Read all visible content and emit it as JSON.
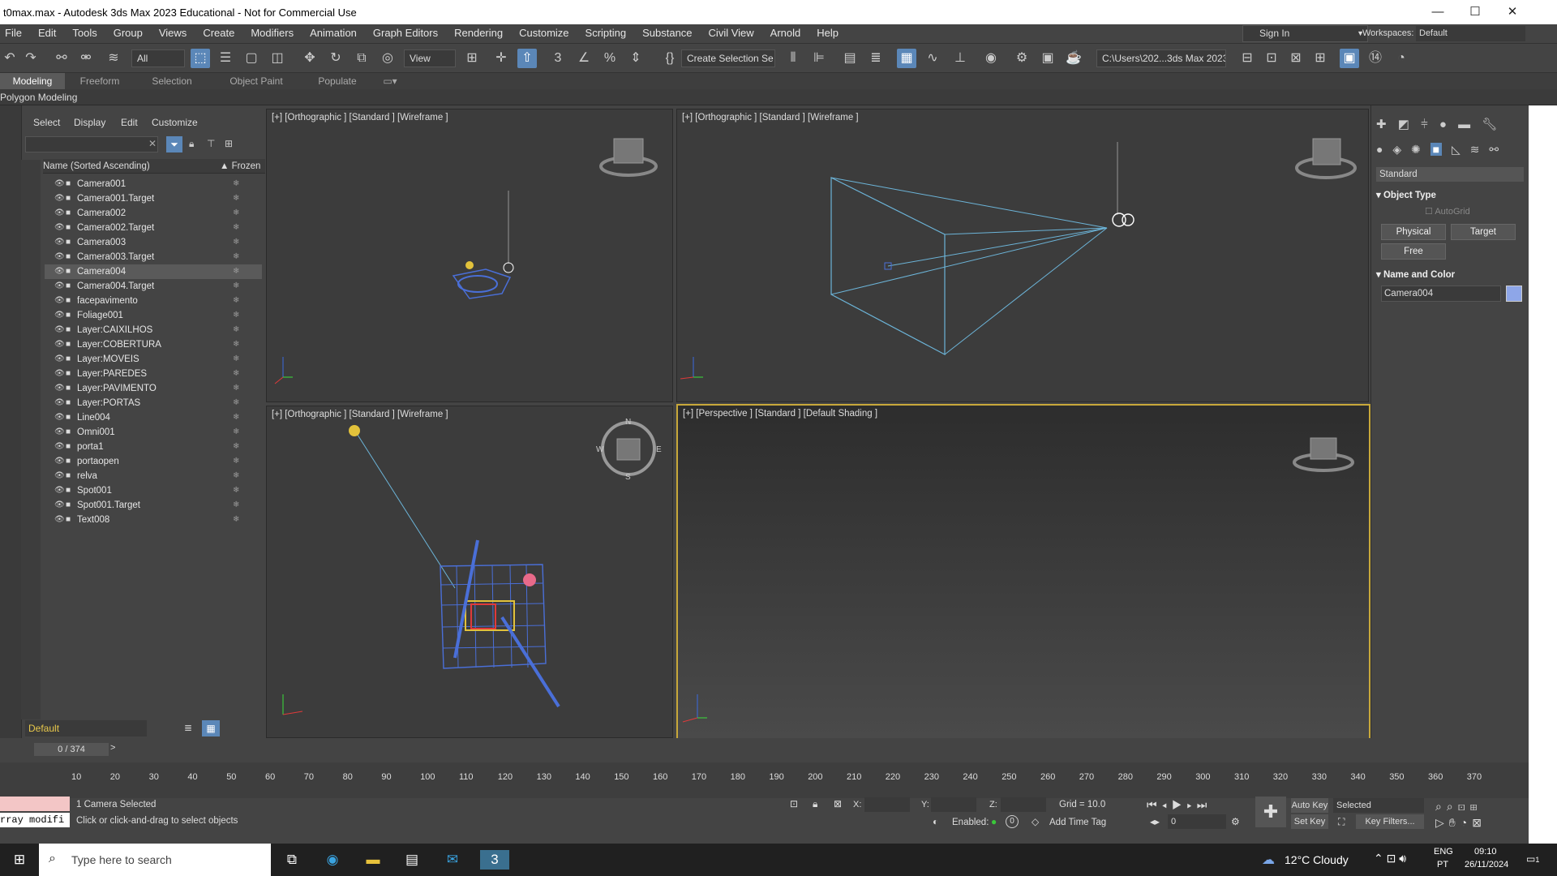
{
  "window": {
    "title": "t0max.max - Autodesk 3ds Max 2023 Educational - Not for Commercial Use",
    "minimize": "—",
    "maximize": "☐",
    "close": "✕"
  },
  "menu": [
    "File",
    "Edit",
    "Tools",
    "Group",
    "Views",
    "Create",
    "Modifiers",
    "Animation",
    "Graph Editors",
    "Rendering",
    "Customize",
    "Scripting",
    "Substance",
    "Civil View",
    "Arnold",
    "Help"
  ],
  "signin": "Sign In",
  "workspaces_label": "Workspaces:",
  "workspace": "Default",
  "toolbar": {
    "filter": "All",
    "refcoord": "View",
    "selset": "Create Selection Se",
    "path": "C:\\Users\\202...3ds Max 2023"
  },
  "ribbon_tabs": [
    "Modeling",
    "Freeform",
    "Selection",
    "Object Paint",
    "Populate"
  ],
  "sub_ribbon": "Polygon Modeling",
  "scene": {
    "tabs": [
      "Select",
      "Display",
      "Edit",
      "Customize"
    ],
    "col_name": "Name (Sorted Ascending)",
    "col_frozen": "▲ Frozen",
    "items": [
      "Camera001",
      "Camera001.Target",
      "Camera002",
      "Camera002.Target",
      "Camera003",
      "Camera003.Target",
      "Camera004",
      "Camera004.Target",
      "facepavimento",
      "Foliage001",
      "Layer:CAIXILHOS",
      "Layer:COBERTURA",
      "Layer:MOVEIS",
      "Layer:PAREDES",
      "Layer:PAVIMENTO",
      "Layer:PORTAS",
      "Line004",
      "Omni001",
      "porta1",
      "portaopen",
      "relva",
      "Spot001",
      "Spot001.Target",
      "Text008"
    ],
    "selected_index": 6,
    "layer": "Default"
  },
  "viewports": {
    "tl": "[+] [Orthographic ] [Standard ] [Wireframe ]",
    "tr": "[+] [Orthographic ] [Standard ] [Wireframe ]",
    "bl": "[+] [Orthographic ] [Standard ] [Wireframe ]",
    "br": "[+] [Perspective ] [Standard ] [Default Shading ]"
  },
  "command": {
    "dropdown": "Standard",
    "object_type": "Object Type",
    "autogrid": "AutoGrid",
    "physical": "Physical",
    "target": "Target",
    "free": "Free",
    "name_color": "Name and Color",
    "name": "Camera004",
    "swatch": "#8ea6e8"
  },
  "time": {
    "frame": "0 / 374",
    "ticks": [
      "10",
      "20",
      "30",
      "40",
      "50",
      "60",
      "70",
      "80",
      "90",
      "100",
      "110",
      "120",
      "130",
      "140",
      "150",
      "160",
      "170",
      "180",
      "190",
      "200",
      "210",
      "220",
      "230",
      "240",
      "250",
      "260",
      "270",
      "280",
      "290",
      "300",
      "310",
      "320",
      "330",
      "340",
      "350",
      "360",
      "370"
    ]
  },
  "status": {
    "selected": "1 Camera Selected",
    "hint": "Click or click-and-drag to select objects",
    "script": "rray modifi",
    "x": "X:",
    "y": "Y:",
    "z": "Z:",
    "grid": "Grid = 10.0",
    "enabled": "Enabled:",
    "add_time_tag": "Add Time Tag",
    "autokey": "Auto Key",
    "setkey": "Set Key",
    "selected_dd": "Selected",
    "keyfilters": "Key Filters...",
    "frame_val": "0"
  },
  "taskbar": {
    "search": "Type here to search",
    "weather": "12°C  Cloudy",
    "lang": "ENG",
    "region": "PT",
    "time": "09:10",
    "date": "26/11/2024",
    "notif": "1"
  }
}
